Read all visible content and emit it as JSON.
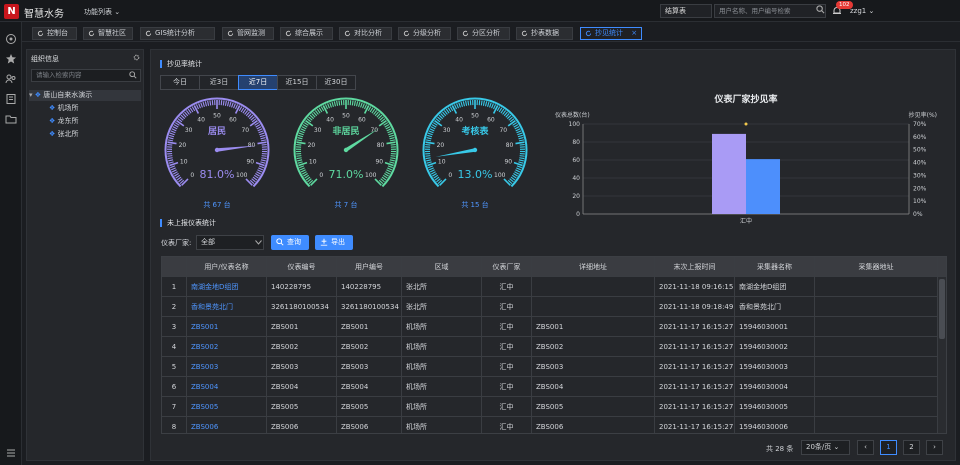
{
  "app": {
    "name": "智慧水务",
    "function_list": "功能列表 ⌄"
  },
  "topbar": {
    "dropdown": "结算表",
    "search_placeholder": "用户名称、用户编号检索",
    "badge": "102",
    "user": "zzg1 ⌄"
  },
  "tabs": [
    {
      "label": "控制台"
    },
    {
      "label": "智慧社区"
    },
    {
      "label": "GIS统计分析"
    },
    {
      "label": "管网监测"
    },
    {
      "label": "综合展示"
    },
    {
      "label": "对比分析"
    },
    {
      "label": "分级分析"
    },
    {
      "label": "分区分析"
    },
    {
      "label": "抄表数据"
    },
    {
      "label": "抄见统计",
      "close": "×"
    }
  ],
  "tree": {
    "title": "组织信息",
    "search_placeholder": "请输入检索内容",
    "root": "唐山自来水演示",
    "children": [
      "机场所",
      "龙东所",
      "张北所"
    ]
  },
  "main": {
    "section_rate": "抄见率统计",
    "ranges": [
      "今日",
      "近3日",
      "近7日",
      "近15日",
      "近30日"
    ],
    "active_range": "近7日",
    "gauges": [
      {
        "name": "居民",
        "value": "81.0%",
        "fraction": 0.81,
        "total": "共 67 台",
        "color": "#9b8cf0"
      },
      {
        "name": "非居民",
        "value": "71.0%",
        "fraction": 0.71,
        "total": "共 7 台",
        "color": "#5ed9a0"
      },
      {
        "name": "考核表",
        "value": "13.0%",
        "fraction": 0.13,
        "total": "共 15 台",
        "color": "#38c9e8"
      }
    ],
    "gauge_ticks": [
      "0",
      "10",
      "20",
      "30",
      "40",
      "50",
      "60",
      "70",
      "80",
      "90",
      "100"
    ],
    "section_unreported": "未上报仪表统计",
    "filter_label": "仪表厂家:",
    "filter_value": "全部",
    "query_button": "查询",
    "export_button": "导出"
  },
  "chart_data": {
    "type": "bar",
    "title": "仪表厂家抄见率",
    "ylabel_left": "仪表总数(台)",
    "ylabel_right": "抄见率(%)",
    "categories": [
      "汇中"
    ],
    "y_left_ticks": [
      "0",
      "20",
      "40",
      "60",
      "80",
      "100"
    ],
    "y_right_ticks": [
      "0%",
      "10%",
      "20%",
      "30%",
      "40%",
      "50%",
      "60%",
      "70%"
    ],
    "ylim_left": [
      0,
      100
    ],
    "ylim_right": [
      0,
      70
    ],
    "series": [
      {
        "values": [
          89
        ],
        "axis": "left",
        "color": "#a99bf5"
      },
      {
        "values": [
          61
        ],
        "axis": "left",
        "color": "#4d8ffc"
      }
    ],
    "point_marker": {
      "value": 70,
      "axis": "right",
      "color": "#f2c94c"
    }
  },
  "table": {
    "headers": [
      "",
      "用户/仪表名称",
      "仪表编号",
      "用户编号",
      "区域",
      "仪表厂家",
      "详细地址",
      "末次上报时间",
      "采集器名称",
      "采集器地址"
    ],
    "rows": [
      [
        "1",
        "南湖金地D组团",
        "140228795",
        "140228795",
        "张北所",
        "汇中",
        "",
        "2021-11-18 09:16:15",
        "南湖金地D组团",
        ""
      ],
      [
        "2",
        "香和景苑北门",
        "3261180100534",
        "3261180100534",
        "张北所",
        "汇中",
        "",
        "2021-11-18 09:18:49",
        "香和景苑北门",
        ""
      ],
      [
        "3",
        "ZBS001",
        "ZBS001",
        "ZBS001",
        "机场所",
        "汇中",
        "ZBS001",
        "2021-11-17 16:15:27",
        "15946030001",
        ""
      ],
      [
        "4",
        "ZBS002",
        "ZBS002",
        "ZBS002",
        "机场所",
        "汇中",
        "ZBS002",
        "2021-11-17 16:15:27",
        "15946030002",
        ""
      ],
      [
        "5",
        "ZBS003",
        "ZBS003",
        "ZBS003",
        "机场所",
        "汇中",
        "ZBS003",
        "2021-11-17 16:15:27",
        "15946030003",
        ""
      ],
      [
        "6",
        "ZBS004",
        "ZBS004",
        "ZBS004",
        "机场所",
        "汇中",
        "ZBS004",
        "2021-11-17 16:15:27",
        "15946030004",
        ""
      ],
      [
        "7",
        "ZBS005",
        "ZBS005",
        "ZBS005",
        "机场所",
        "汇中",
        "ZBS005",
        "2021-11-17 16:15:27",
        "15946030005",
        ""
      ],
      [
        "8",
        "ZBS006",
        "ZBS006",
        "ZBS006",
        "机场所",
        "汇中",
        "ZBS006",
        "2021-11-17 16:15:27",
        "15946030006",
        ""
      ]
    ]
  },
  "pagination": {
    "total": "共 28 条",
    "page_size": "20条/页 ⌄",
    "prev": "‹",
    "next": "›",
    "pages": [
      "1",
      "2"
    ],
    "current": "1"
  }
}
